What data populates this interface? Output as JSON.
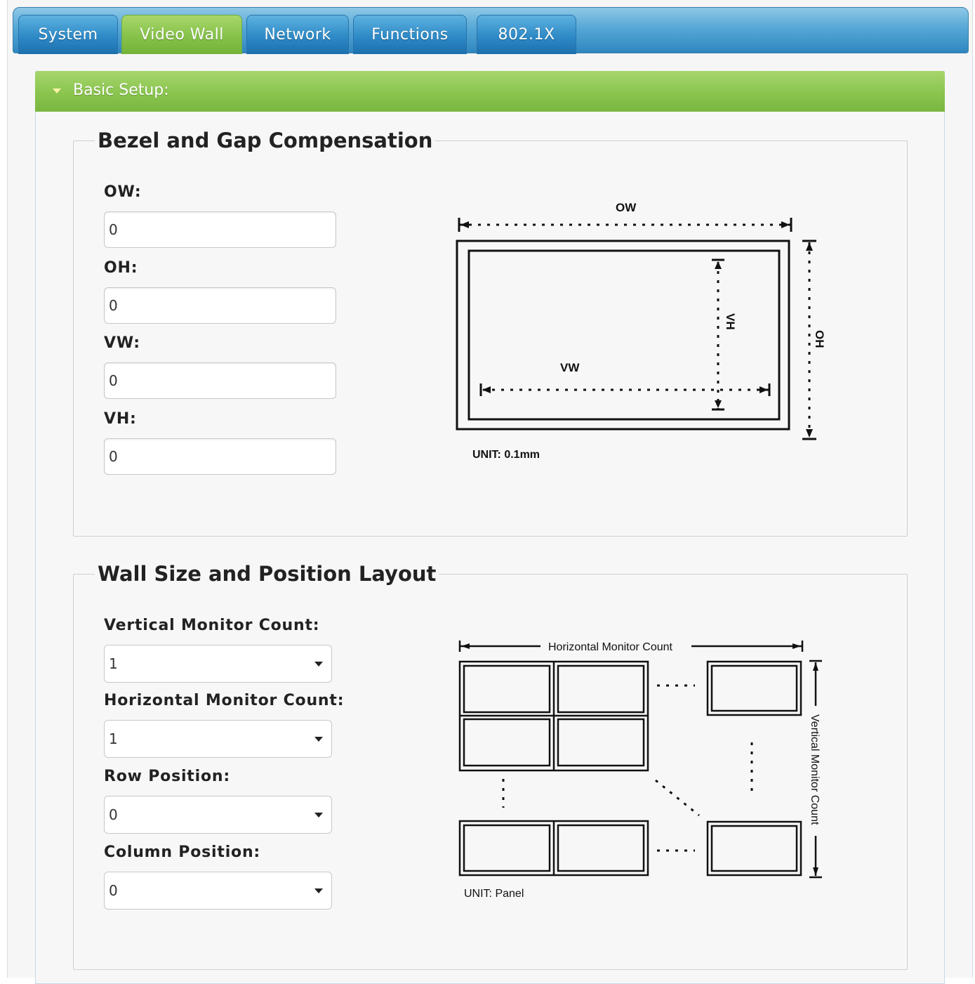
{
  "tabs": [
    {
      "label": "System",
      "active": false
    },
    {
      "label": "Video Wall",
      "active": true
    },
    {
      "label": "Network",
      "active": false
    },
    {
      "label": "Functions",
      "active": false
    },
    {
      "label": "802.1X",
      "active": false
    }
  ],
  "section": {
    "title": "Basic Setup:"
  },
  "bezel": {
    "legend": "Bezel and Gap Compensation",
    "fields": [
      {
        "label": "OW:",
        "value": "0"
      },
      {
        "label": "OH:",
        "value": "0"
      },
      {
        "label": "VW:",
        "value": "0"
      },
      {
        "label": "VH:",
        "value": "0"
      }
    ],
    "diagram": {
      "ow": "OW",
      "oh": "OH",
      "vw": "VW",
      "vh": "VH",
      "unit": "UNIT: 0.1mm"
    }
  },
  "wall": {
    "legend": "Wall Size and Position Layout",
    "fields": [
      {
        "label": "Vertical Monitor Count:",
        "value": "1"
      },
      {
        "label": "Horizontal Monitor Count:",
        "value": "1"
      },
      {
        "label": "Row Position:",
        "value": "0"
      },
      {
        "label": "Column Position:",
        "value": "0"
      }
    ],
    "diagram": {
      "horizontal": "Horizontal Monitor Count",
      "vertical": "Vertical Monitor Count",
      "unit": "UNIT: Panel"
    }
  },
  "colors": {
    "tab_blue": "#2e8ac6",
    "tab_active_green": "#86c24a",
    "section_green": "#88c34c"
  }
}
